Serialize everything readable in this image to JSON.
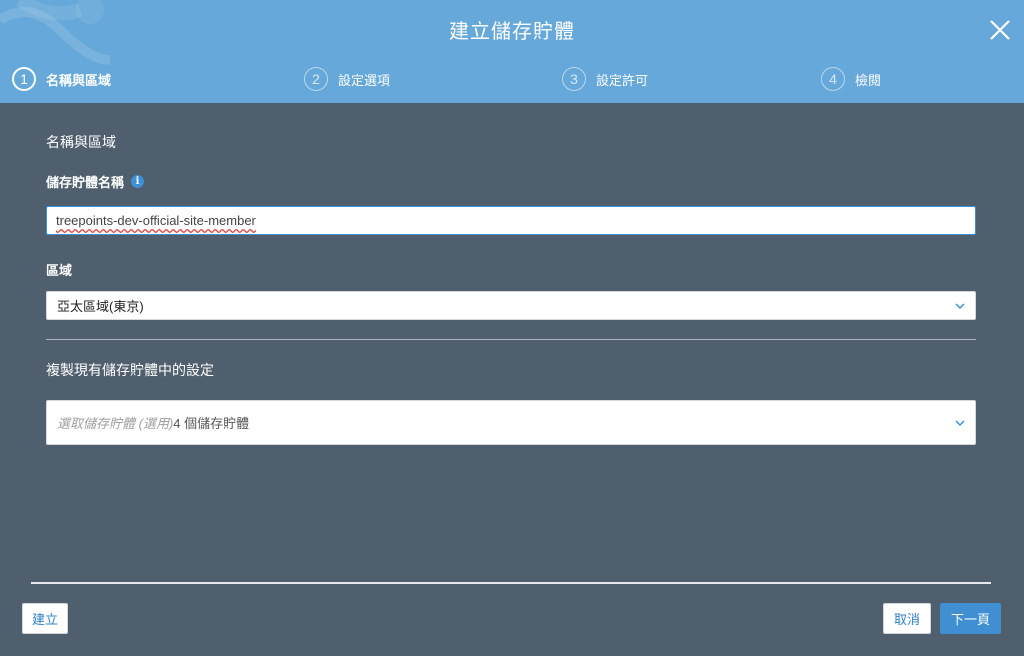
{
  "modal": {
    "title": "建立儲存貯體",
    "colors": {
      "header": "#66a8d9",
      "body": "#4f5f6e",
      "accent": "#3d8fd6"
    }
  },
  "steps": [
    {
      "number": "1",
      "label": "名稱與區域",
      "active": true
    },
    {
      "number": "2",
      "label": "設定選項",
      "active": false
    },
    {
      "number": "3",
      "label": "設定許可",
      "active": false
    },
    {
      "number": "4",
      "label": "檢閱",
      "active": false
    }
  ],
  "form": {
    "section_title": "名稱與區域",
    "bucket_name_label": "儲存貯體名稱",
    "bucket_name_value": "treepoints-dev-official-site-member",
    "region_label": "區域",
    "region_value": "亞太區域(東京)",
    "copy_section_title": "複製現有儲存貯體中的設定",
    "copy_placeholder": "選取儲存貯體 (選用)",
    "copy_count": "4 個儲存貯體"
  },
  "footer": {
    "create_label": "建立",
    "cancel_label": "取消",
    "next_label": "下一頁"
  }
}
